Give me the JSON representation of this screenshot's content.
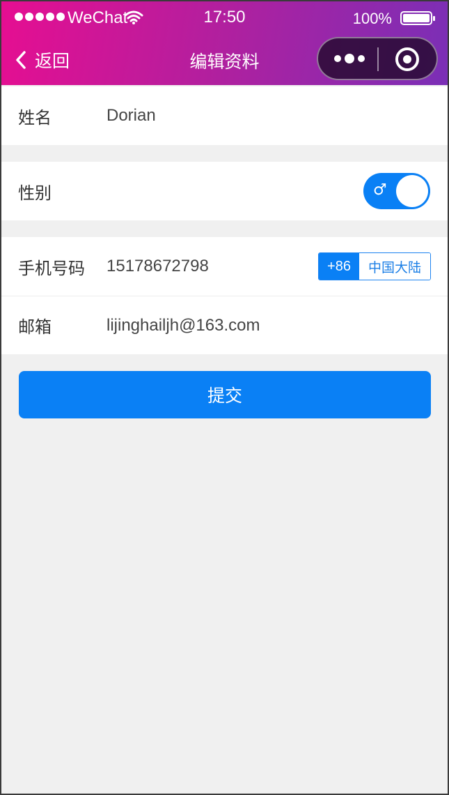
{
  "status_bar": {
    "carrier": "WeChat",
    "time": "17:50",
    "battery": "100%"
  },
  "nav": {
    "back_label": "返回",
    "title": "编辑资料"
  },
  "form": {
    "name": {
      "label": "姓名",
      "value": "Dorian"
    },
    "gender": {
      "label": "性别",
      "symbol": "♂",
      "state": "male"
    },
    "phone": {
      "label": "手机号码",
      "value": "15178672798",
      "country_code": "+86",
      "region": "中国大陆"
    },
    "email": {
      "label": "邮箱",
      "value": "lijinghailjh@163.com"
    }
  },
  "submit_label": "提交",
  "colors": {
    "primary": "#0a80f5",
    "header_gradient": [
      "#e60e91",
      "#7a2fb6"
    ],
    "background": "#f0f0f0"
  }
}
